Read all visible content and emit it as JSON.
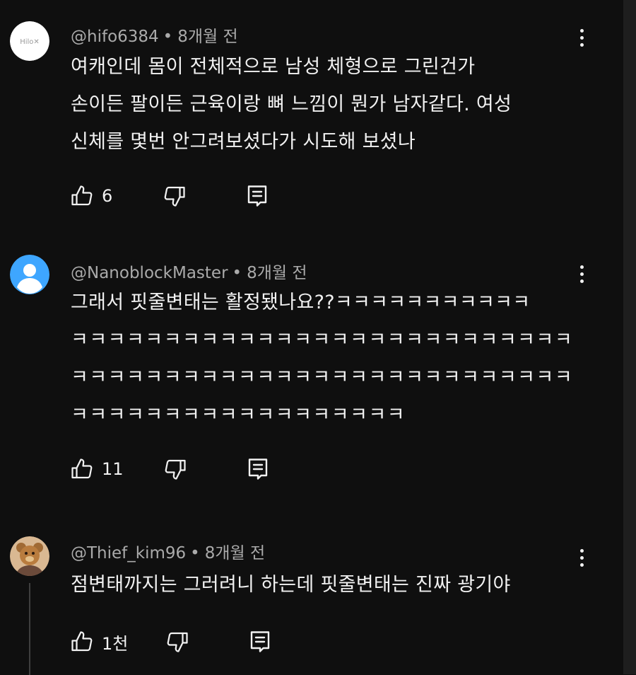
{
  "comments": [
    {
      "author": "@hifo6384",
      "time": "8개월 전",
      "avatar_text": "Hilo✕",
      "lines": [
        "여캐인데 몸이 전체적으로 남성 체형으로 그린건가",
        "손이든 팔이든 근육이랑 뼈 느낌이 뭔가 남자같다. 여성",
        "신체를 몇번 안그려보셨다가 시도해 보셨나"
      ],
      "likes": "6"
    },
    {
      "author": "@NanoblockMaster",
      "time": "8개월 전",
      "lines": [
        "그래서 핏줄변태는 활정됐나요??ㅋㅋㅋㅋㅋㅋㅋㅋㅋㅋㅋ",
        "ㅋㅋㅋㅋㅋㅋㅋㅋㅋㅋㅋㅋㅋㅋㅋㅋㅋㅋㅋㅋㅋㅋㅋㅋㅋㅋㅋ",
        "ㅋㅋㅋㅋㅋㅋㅋㅋㅋㅋㅋㅋㅋㅋㅋㅋㅋㅋㅋㅋㅋㅋㅋㅋㅋㅋㅋ",
        "ㅋㅋㅋㅋㅋㅋㅋㅋㅋㅋㅋㅋㅋㅋㅋㅋㅋㅋ"
      ],
      "likes": "11"
    },
    {
      "author": "@Thief_kim96",
      "time": "8개월 전",
      "lines": [
        "점변태까지는 그러려니 하는데 핏줄변태는 진짜 광기야"
      ],
      "likes": "1천"
    }
  ],
  "separator": "•",
  "icons": {
    "like": "thumb-up-icon",
    "dislike": "thumb-down-icon",
    "reply": "comment-reply-icon",
    "more": "more-vertical-icon"
  },
  "colors": {
    "background": "#0f0f0f",
    "text": "#f1f1f1",
    "meta": "#aaaaaa",
    "default_avatar": "#3ea6ff"
  }
}
